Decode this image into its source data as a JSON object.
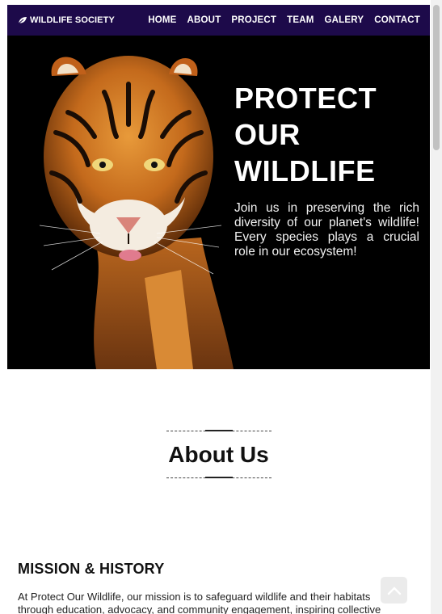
{
  "brand": {
    "icon": "leaf-icon",
    "name": "WILDLIFE SOCIETY"
  },
  "nav": {
    "items": [
      "HOME",
      "ABOUT",
      "PROJECT",
      "TEAM",
      "GALERY",
      "CONTACT"
    ]
  },
  "hero": {
    "title_lines": [
      "PROTECT",
      "OUR",
      "WILDLIFE"
    ],
    "description": "Join us in preserving the rich diversity of our planet's wildlife! Every species plays a crucial role in our ecosystem!"
  },
  "about": {
    "title": "About Us",
    "mission_heading": "MISSION & HISTORY",
    "mission_text": "At Protect Our Wildlife, our mission is to safeguard wildlife and their habitats through education, advocacy, and community engagement, inspiring collective action for a"
  },
  "controls": {
    "scroll_top_icon": "chevron-up-icon"
  },
  "colors": {
    "navbar_bg": "#1d0a4a",
    "hero_bg": "#000000"
  }
}
